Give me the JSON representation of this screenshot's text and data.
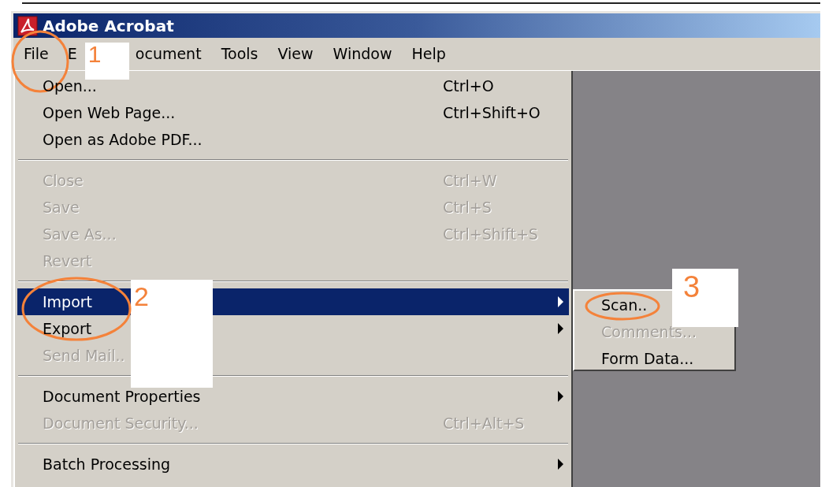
{
  "window": {
    "title": "Adobe Acrobat"
  },
  "menu_bar": [
    {
      "label": "File",
      "selected": true
    },
    {
      "label": "E",
      "selected": false
    },
    {
      "label": "ocument",
      "selected": false
    },
    {
      "label": "Tools",
      "selected": false
    },
    {
      "label": "View",
      "selected": false
    },
    {
      "label": "Window",
      "selected": false
    },
    {
      "label": "Help",
      "selected": false
    }
  ],
  "file_menu": {
    "groups": [
      [
        {
          "label": "Open...",
          "shortcut": "Ctrl+O",
          "disabled": false,
          "submenu": false,
          "selected": false
        },
        {
          "label": "Open Web Page...",
          "shortcut": "Ctrl+Shift+O",
          "disabled": false,
          "submenu": false,
          "selected": false
        },
        {
          "label": "Open as Adobe PDF...",
          "disabled": false,
          "submenu": false,
          "selected": false
        }
      ],
      [
        {
          "label": "Close",
          "shortcut": "Ctrl+W",
          "disabled": true,
          "submenu": false,
          "selected": false
        },
        {
          "label": "Save",
          "shortcut": "Ctrl+S",
          "disabled": true,
          "submenu": false,
          "selected": false
        },
        {
          "label": "Save As...",
          "shortcut": "Ctrl+Shift+S",
          "disabled": true,
          "submenu": false,
          "selected": false
        },
        {
          "label": "Revert",
          "disabled": true,
          "submenu": false,
          "selected": false
        }
      ],
      [
        {
          "label": "Import",
          "disabled": false,
          "submenu": true,
          "selected": true
        },
        {
          "label": "Export",
          "disabled": false,
          "submenu": true,
          "selected": false
        },
        {
          "label": "Send Mail..",
          "disabled": true,
          "submenu": false,
          "selected": false
        }
      ],
      [
        {
          "label": "Document Properties",
          "disabled": false,
          "submenu": true,
          "selected": false
        },
        {
          "label": "Document Security...",
          "shortcut": "Ctrl+Alt+S",
          "disabled": true,
          "submenu": false,
          "selected": false
        }
      ],
      [
        {
          "label": "Batch Processing",
          "disabled": false,
          "submenu": true,
          "selected": false
        }
      ]
    ]
  },
  "import_submenu": [
    {
      "label": "Scan..",
      "disabled": false
    },
    {
      "label": "Comments...",
      "disabled": true
    },
    {
      "label": "Form Data...",
      "disabled": false
    }
  ],
  "annotations": [
    {
      "number": "1"
    },
    {
      "number": "2"
    },
    {
      "number": "3"
    }
  ]
}
